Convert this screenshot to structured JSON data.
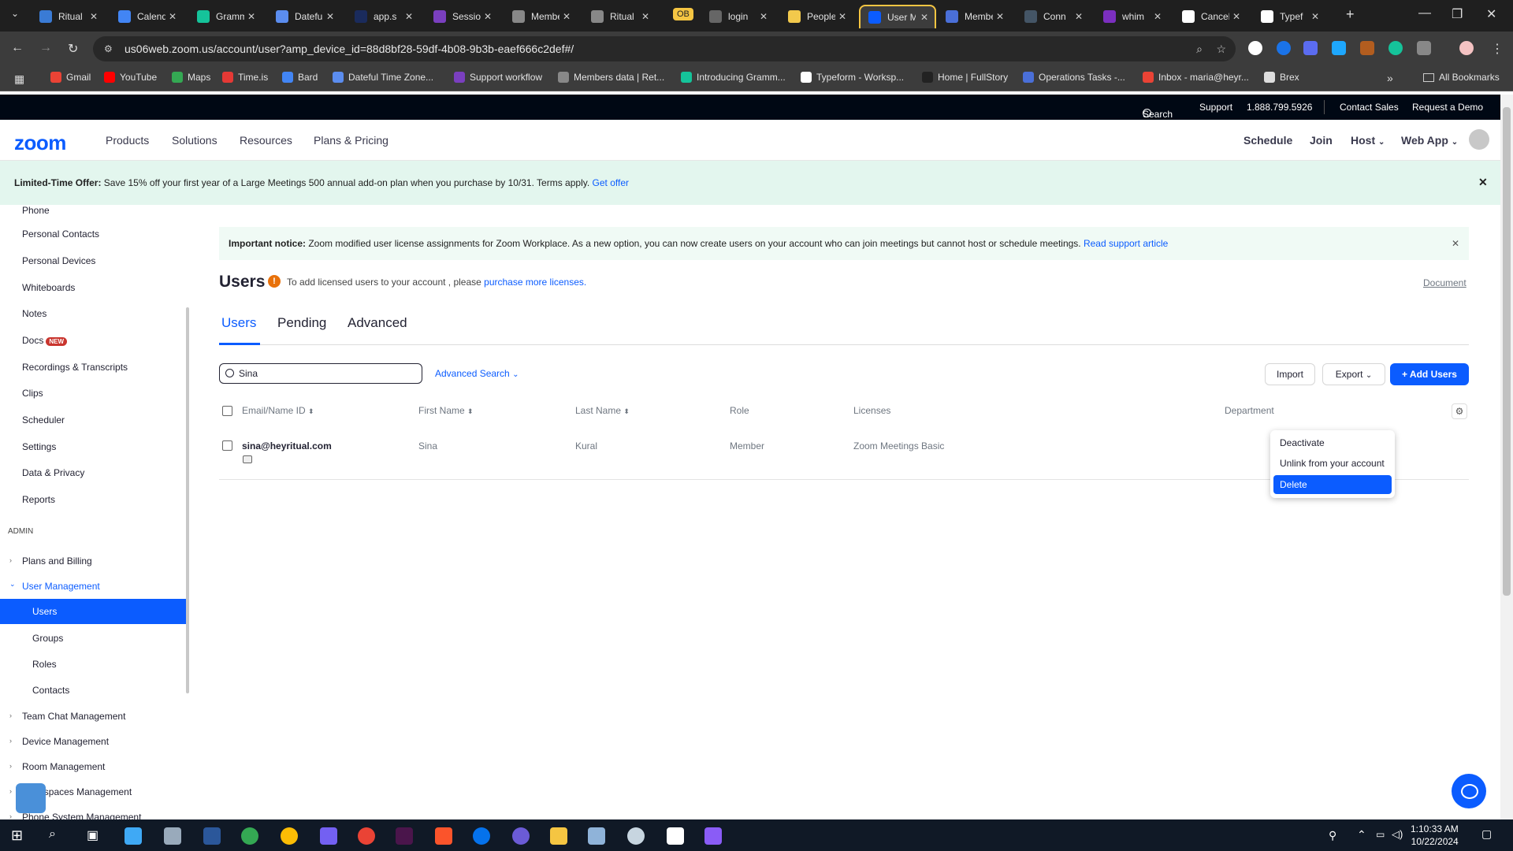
{
  "browser": {
    "tabs": [
      {
        "title": "Ritual",
        "color": "#3a7bd5"
      },
      {
        "title": "Calendar",
        "color": "#4285f4"
      },
      {
        "title": "Grammarly",
        "color": "#15c39a"
      },
      {
        "title": "Dateful",
        "color": "#5b8def"
      },
      {
        "title": "app.s",
        "color": "#1a2b5c"
      },
      {
        "title": "Session",
        "color": "#7a3fbf"
      },
      {
        "title": "Members",
        "color": "#888888"
      },
      {
        "title": "Ritual",
        "color": "#888888"
      },
      {
        "title": "login",
        "color": "#666666"
      },
      {
        "title": "People",
        "color": "#f2c94c"
      },
      {
        "title": "User M",
        "color": "#0b5cff"
      },
      {
        "title": "Members",
        "color": "#4a6fd8"
      },
      {
        "title": "Conn",
        "color": "#445566"
      },
      {
        "title": "whim",
        "color": "#7b2fbf"
      },
      {
        "title": "Cancel",
        "color": "#ffffff"
      },
      {
        "title": "Typef",
        "color": "#ffffff"
      }
    ],
    "tab_badge": "OB",
    "new_tab": "+",
    "url": "us06web.zoom.us/account/user?amp_device_id=88d8bf28-59df-4b08-9b3b-eaef666c2def#/",
    "bookmarks": [
      {
        "label": "Gmail",
        "color": "#ea4335"
      },
      {
        "label": "YouTube",
        "color": "#ff0000"
      },
      {
        "label": "Maps",
        "color": "#34a853"
      },
      {
        "label": "Time.is",
        "color": "#e53935"
      },
      {
        "label": "Bard",
        "color": "#4285f4"
      },
      {
        "label": "Dateful Time Zone...",
        "color": "#5b8def"
      },
      {
        "label": "Support workflow",
        "color": "#7a3fbf"
      },
      {
        "label": "Members data | Ret...",
        "color": "#888888"
      },
      {
        "label": "Introducing Gramm...",
        "color": "#15c39a"
      },
      {
        "label": "Typeform - Worksp...",
        "color": "#ffffff"
      },
      {
        "label": "Home | FullStory",
        "color": "#222222"
      },
      {
        "label": "Operations Tasks -...",
        "color": "#4a6fd8"
      },
      {
        "label": "Inbox - maria@heyr...",
        "color": "#ea4335"
      },
      {
        "label": "Brex",
        "color": "#dddddd"
      }
    ],
    "bookmarks_more": "»",
    "all_bookmarks": "All Bookmarks"
  },
  "zoom": {
    "top_strip": {
      "search": "Search",
      "support": "Support",
      "phone": "1.888.799.5926",
      "contact_sales": "Contact Sales",
      "request_demo": "Request a Demo"
    },
    "logo": "zoom",
    "nav": [
      "Products",
      "Solutions",
      "Resources",
      "Plans & Pricing"
    ],
    "nav_right": [
      "Schedule",
      "Join",
      "Host",
      "Web App"
    ],
    "promo": {
      "lead": "Limited-Time Offer:",
      "text": " Save 15% off your first year of a Large Meetings 500 annual add-on plan when you purchase by 10/31. Terms apply. ",
      "link": "Get offer"
    },
    "sidebar": {
      "items": [
        "Phone",
        "Personal Contacts",
        "Personal Devices",
        "Whiteboards",
        "Notes",
        "Docs",
        "Recordings & Transcripts",
        "Clips",
        "Scheduler",
        "Settings",
        "Data & Privacy",
        "Reports"
      ],
      "docs_badge": "NEW",
      "admin_header": "ADMIN",
      "admin_items": [
        "Plans and Billing",
        "User Management"
      ],
      "user_mgmt_sub": [
        "Users",
        "Groups",
        "Roles",
        "Contacts"
      ],
      "admin_more": [
        "Team Chat Management",
        "Device Management",
        "Room Management",
        "Workspaces Management",
        "Phone System Management"
      ]
    },
    "notice": {
      "lead": "Important notice:",
      "text": " Zoom modified user license assignments for Zoom Workplace. As a new option, you can now create users on your account who can join meetings but cannot host or schedule meetings. ",
      "link": "Read support article"
    },
    "page_title": "Users",
    "license_warning": {
      "text": "To add licensed users to your account ,  please ",
      "link": "purchase more licenses."
    },
    "document_link": "Document",
    "tabs": [
      "Users",
      "Pending",
      "Advanced"
    ],
    "search_value": "Sina",
    "advanced_search": "Advanced Search",
    "buttons": {
      "import": "Import",
      "export": "Export",
      "add_users": "+  Add Users"
    },
    "table": {
      "headers": [
        "Email/Name ID",
        "First Name",
        "Last Name",
        "Role",
        "Licenses",
        "Department"
      ],
      "rows": [
        {
          "email": "sina@heyritual.com",
          "first": "Sina",
          "last": "Kural",
          "role": "Member",
          "license": "Zoom Meetings Basic"
        }
      ]
    },
    "row_menu": [
      "Deactivate",
      "Unlink from your account",
      "Delete"
    ]
  },
  "taskbar": {
    "time": "1:10:33 AM",
    "date": "10/22/2024"
  }
}
